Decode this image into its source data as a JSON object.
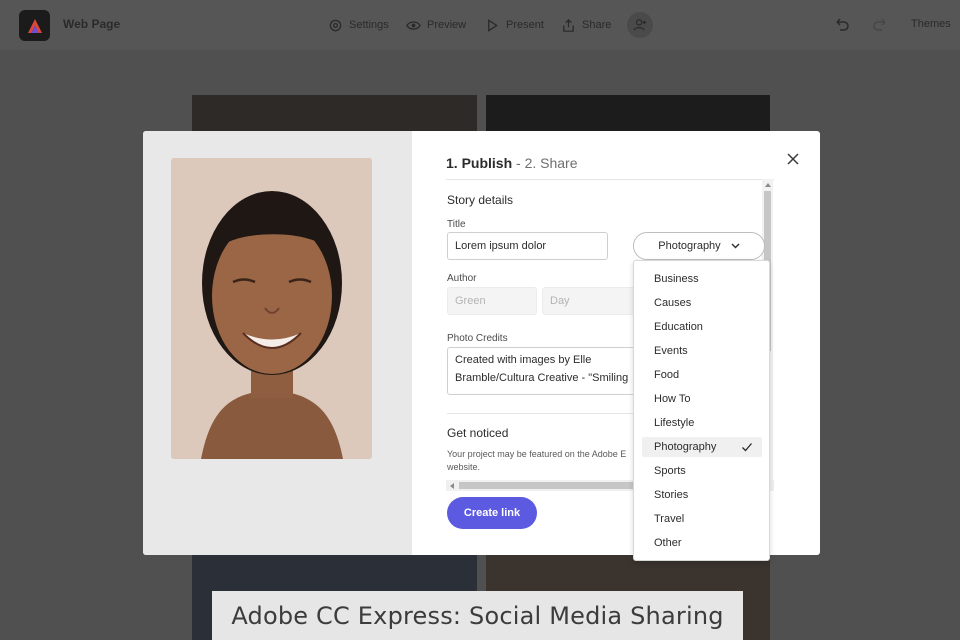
{
  "topbar": {
    "doc_title": "Web Page",
    "settings_label": "Settings",
    "preview_label": "Preview",
    "present_label": "Present",
    "share_label": "Share",
    "themes_label": "Themes"
  },
  "modal": {
    "step1": "1. Publish",
    "step_sep": " - ",
    "step2": "2. Share",
    "story_details_heading": "Story details",
    "title_label": "Title",
    "title_value": "Lorem ipsum dolor",
    "category_value": "Photography",
    "author_label": "Author",
    "author_first_placeholder": "Green",
    "author_last_placeholder": "Day",
    "photo_credits_label": "Photo Credits",
    "photo_credits_line1": "Created with images by Elle",
    "photo_credits_line2": "Bramble/Cultura Creative - \"Smiling",
    "get_noticed_heading": "Get noticed",
    "get_noticed_line1": "Your project may be featured on the Adobe E",
    "get_noticed_line2": "website.",
    "create_link_label": "Create link"
  },
  "dropdown": {
    "options": [
      "Business",
      "Causes",
      "Education",
      "Events",
      "Food",
      "How To",
      "Lifestyle",
      "Photography",
      "Sports",
      "Stories",
      "Travel",
      "Other"
    ],
    "selected": "Photography"
  },
  "caption": "Adobe CC Express: Social Media Sharing",
  "colors": {
    "accent": "#5b5ae0",
    "overlay": "#505050"
  }
}
